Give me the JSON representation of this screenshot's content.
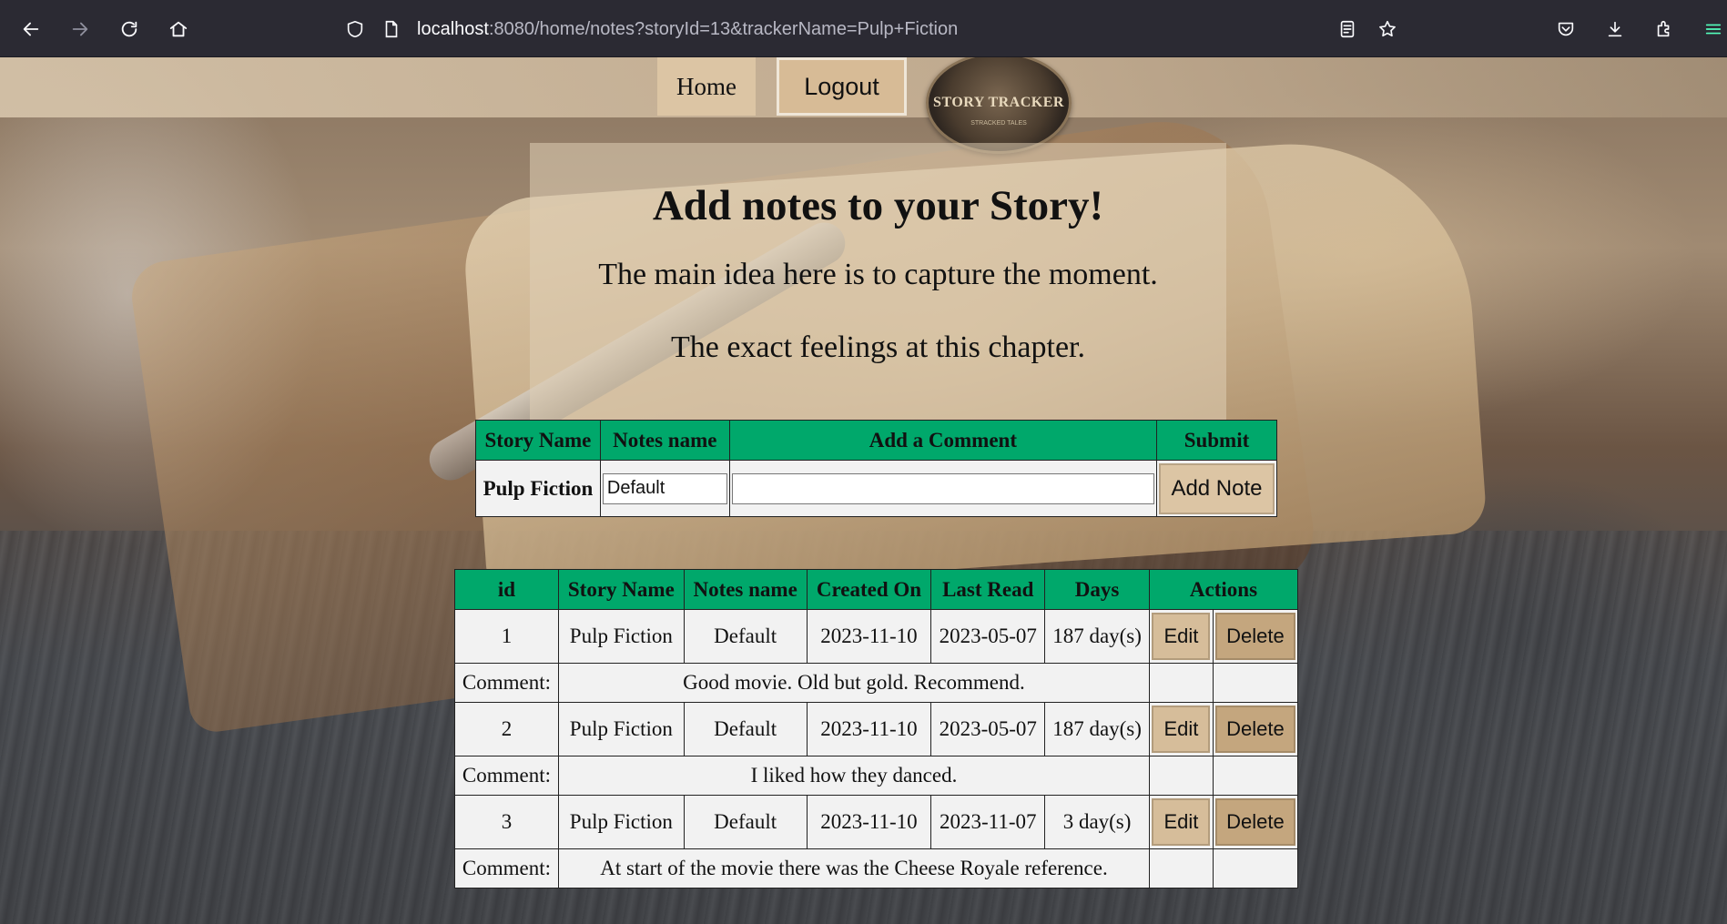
{
  "browser": {
    "url_host": "localhost",
    "url_rest": ":8080/home/notes?storyId=13&trackerName=Pulp+Fiction"
  },
  "navbar": {
    "home_label": "Home",
    "logout_label": "Logout",
    "logo_text": "STORY TRACKER",
    "logo_subtext": "STRACKED TALES"
  },
  "hero": {
    "title": "Add notes to your Story!",
    "line1": "The main idea here is to capture the moment.",
    "line2": "The exact feelings at this chapter."
  },
  "form": {
    "headers": [
      "Story Name",
      "Notes name",
      "Add a Comment",
      "Submit"
    ],
    "story_name": "Pulp Fiction",
    "notes_name_value": "Default",
    "comment_value": "",
    "submit_label": "Add Note"
  },
  "notes": {
    "headers": [
      "id",
      "Story Name",
      "Notes name",
      "Created On",
      "Last Read",
      "Days",
      "Actions"
    ],
    "comment_label": "Comment:",
    "edit_label": "Edit",
    "delete_label": "Delete",
    "rows": [
      {
        "id": "1",
        "story": "Pulp Fiction",
        "notes_name": "Default",
        "created": "2023-11-10",
        "last_read": "2023-05-07",
        "days": "187 day(s)",
        "comment": "Good movie. Old but gold. Recommend."
      },
      {
        "id": "2",
        "story": "Pulp Fiction",
        "notes_name": "Default",
        "created": "2023-11-10",
        "last_read": "2023-05-07",
        "days": "187 day(s)",
        "comment": "I liked how they danced."
      },
      {
        "id": "3",
        "story": "Pulp Fiction",
        "notes_name": "Default",
        "created": "2023-11-10",
        "last_read": "2023-11-07",
        "days": "3 day(s)",
        "comment": "At start of the movie there was the Cheese Royale reference."
      }
    ]
  },
  "colors": {
    "header_green": "#00a86b",
    "button_tan": "#dcc5a4",
    "cell_bg": "#f2f2f2"
  }
}
